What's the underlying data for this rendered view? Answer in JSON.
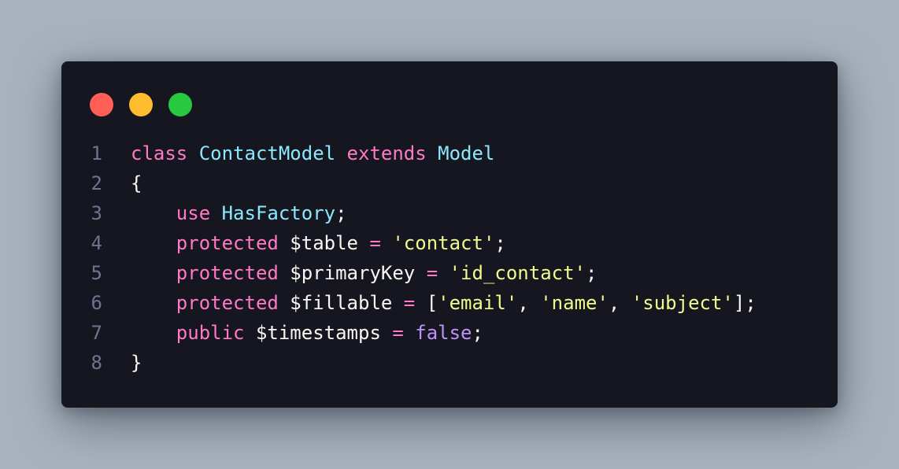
{
  "colors": {
    "background": "#a9b3be",
    "window": "#151620",
    "line_number": "#6d7591",
    "plain": "#f8f8f2",
    "keyword": "#ff79c6",
    "class_name": "#8be9fd",
    "string": "#f1fa8c",
    "boolean": "#bd93f9",
    "dot_close": "#ff5f57",
    "dot_minimize": "#febc2e",
    "dot_maximize": "#28c840"
  },
  "window_controls": [
    "close",
    "minimize",
    "maximize"
  ],
  "lines": [
    {
      "number": "1",
      "tokens": [
        {
          "text": "class",
          "type": "keyword"
        },
        {
          "text": " ",
          "type": "plain"
        },
        {
          "text": "ContactModel",
          "type": "class_name"
        },
        {
          "text": " ",
          "type": "plain"
        },
        {
          "text": "extends",
          "type": "keyword"
        },
        {
          "text": " ",
          "type": "plain"
        },
        {
          "text": "Model",
          "type": "class_name"
        }
      ]
    },
    {
      "number": "2",
      "tokens": [
        {
          "text": "{",
          "type": "plain"
        }
      ]
    },
    {
      "number": "3",
      "tokens": [
        {
          "text": "    ",
          "type": "plain"
        },
        {
          "text": "use",
          "type": "keyword"
        },
        {
          "text": " ",
          "type": "plain"
        },
        {
          "text": "HasFactory",
          "type": "class_name"
        },
        {
          "text": ";",
          "type": "plain"
        }
      ]
    },
    {
      "number": "4",
      "tokens": [
        {
          "text": "    ",
          "type": "plain"
        },
        {
          "text": "protected",
          "type": "keyword"
        },
        {
          "text": " $table ",
          "type": "plain"
        },
        {
          "text": "=",
          "type": "keyword"
        },
        {
          "text": " ",
          "type": "plain"
        },
        {
          "text": "'contact'",
          "type": "string"
        },
        {
          "text": ";",
          "type": "plain"
        }
      ]
    },
    {
      "number": "5",
      "tokens": [
        {
          "text": "    ",
          "type": "plain"
        },
        {
          "text": "protected",
          "type": "keyword"
        },
        {
          "text": " $primaryKey ",
          "type": "plain"
        },
        {
          "text": "=",
          "type": "keyword"
        },
        {
          "text": " ",
          "type": "plain"
        },
        {
          "text": "'id_contact'",
          "type": "string"
        },
        {
          "text": ";",
          "type": "plain"
        }
      ]
    },
    {
      "number": "6",
      "tokens": [
        {
          "text": "    ",
          "type": "plain"
        },
        {
          "text": "protected",
          "type": "keyword"
        },
        {
          "text": " $fillable ",
          "type": "plain"
        },
        {
          "text": "=",
          "type": "keyword"
        },
        {
          "text": " [",
          "type": "plain"
        },
        {
          "text": "'email'",
          "type": "string"
        },
        {
          "text": ", ",
          "type": "plain"
        },
        {
          "text": "'name'",
          "type": "string"
        },
        {
          "text": ", ",
          "type": "plain"
        },
        {
          "text": "'subject'",
          "type": "string"
        },
        {
          "text": "];",
          "type": "plain"
        }
      ]
    },
    {
      "number": "7",
      "tokens": [
        {
          "text": "    ",
          "type": "plain"
        },
        {
          "text": "public",
          "type": "keyword"
        },
        {
          "text": " $timestamps ",
          "type": "plain"
        },
        {
          "text": "=",
          "type": "keyword"
        },
        {
          "text": " ",
          "type": "plain"
        },
        {
          "text": "false",
          "type": "boolean"
        },
        {
          "text": ";",
          "type": "plain"
        }
      ]
    },
    {
      "number": "8",
      "tokens": [
        {
          "text": "}",
          "type": "plain"
        }
      ]
    }
  ]
}
